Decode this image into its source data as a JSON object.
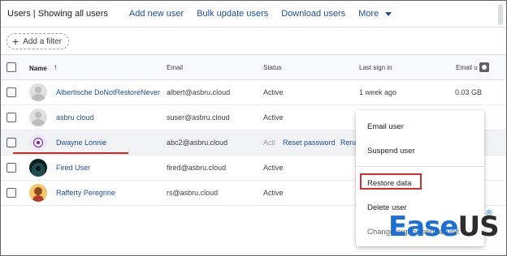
{
  "toolbar": {
    "title_prefix": "Users",
    "title_suffix": "| Showing all users",
    "add_new_user": "Add new user",
    "bulk_update": "Bulk update users",
    "download": "Download users",
    "more": "More"
  },
  "filter": {
    "label": "Add a filter"
  },
  "table": {
    "headers": {
      "name": "Name",
      "email": "Email",
      "status": "Status",
      "last_sign_in": "Last sign in",
      "email_usage": "Email u"
    },
    "rows": [
      {
        "name": "Albertische DoNotRestoreNever",
        "email": "albert@asbru.cloud",
        "status": "Active",
        "last_sign_in": "1 week ago",
        "usage": "0.03 GB"
      },
      {
        "name": "asbru cloud",
        "email": "suser@asbru.cloud",
        "status": "Active",
        "last_sign_in": "",
        "usage": ""
      },
      {
        "name": "Dwayne Lonnie",
        "email": "abc2@asbru.cloud",
        "status": "Acti",
        "last_sign_in": "",
        "usage": ""
      },
      {
        "name": "Fired User",
        "email": "fired@asbru.cloud",
        "status": "Active",
        "last_sign_in": "",
        "usage": ""
      },
      {
        "name": "Rafferty Peregrine",
        "email": "rs@asbru.cloud",
        "status": "Active",
        "last_sign_in": "",
        "usage": ""
      }
    ],
    "hover_actions": {
      "reset_password": "Reset password",
      "rename": "Rena"
    }
  },
  "menu": {
    "email_user": "Email user",
    "suspend_user": "Suspend user",
    "restore_data": "Restore data",
    "delete_user": "Delete user",
    "change_ou": "Change organizational unit"
  },
  "logo": {
    "ease": "Ease",
    "us": "US",
    "reg": "®"
  },
  "colors": {
    "link": "#1a4fa0",
    "highlight_red": "#d32f2f",
    "logo_blue": "#1d6fd4"
  }
}
